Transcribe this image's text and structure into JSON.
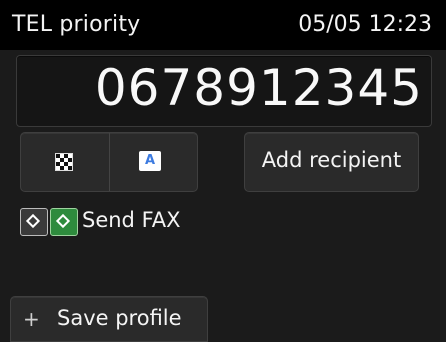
{
  "header": {
    "mode_title": "TEL priority",
    "datetime": "05/05 12:23"
  },
  "number_display": {
    "value": "0678912345"
  },
  "buttons": {
    "quality_icon": "checkerboard-icon",
    "density_icon_letter": "A",
    "add_recipient_label": "Add recipient",
    "save_profile_label": "Save profile",
    "save_profile_icon": "+"
  },
  "start": {
    "send_label": "Send FAX",
    "mono_icon": "start-black-icon",
    "color_icon": "start-color-icon"
  },
  "colors": {
    "background": "#1b1b1b",
    "header": "#000000",
    "accent_green": "#2e8b3d",
    "accent_blue": "#3d7be0"
  }
}
